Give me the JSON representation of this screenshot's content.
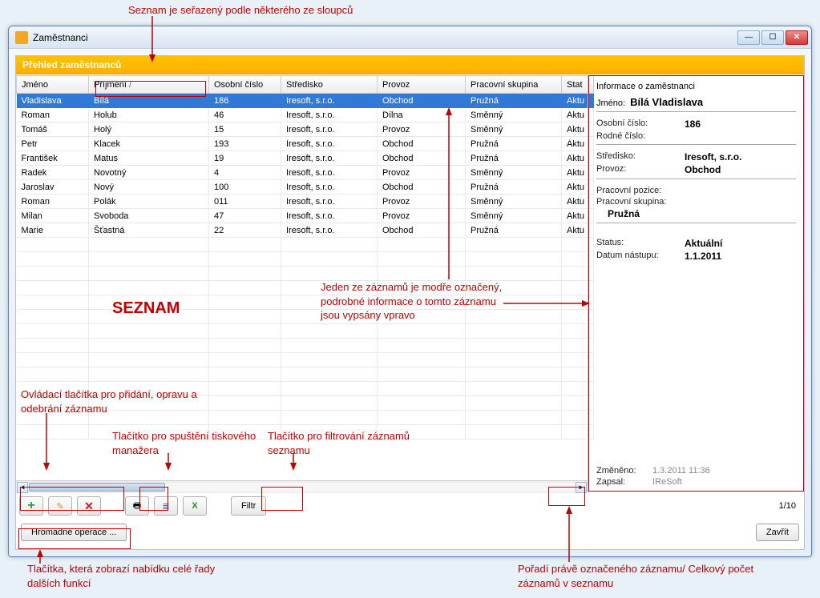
{
  "annotations": {
    "top": "Seznam je seřazený podle některého ze sloupců",
    "seznam": "SEZNAM",
    "right_note": "Jeden ze záznamů je modře označený, podrobné informace o tomto záznamu jsou vypsány vpravo",
    "controls_note": "Ovládací tlačítka pro přidání, opravu a odebrání záznamu",
    "print_note": "Tlačítko pro spuštění tiskového manažera",
    "filter_note": "Tlačítko pro filtrování záznamů seznamu",
    "bottom_left": "Tlačítka, která zobrazí nabídku celé řady dalších funkcí",
    "bottom_right": "Pořadí právě označeného záznamu/ Celkový počet záznamů v seznamu"
  },
  "window": {
    "title": "Zaměstnanci",
    "header": "Přehled zaměstnanců"
  },
  "columns": [
    "Jméno",
    "Příjmení",
    "Osobní číslo",
    "Středisko",
    "Provoz",
    "Pracovní skupina",
    "Stat"
  ],
  "sorted_col_index": 1,
  "rows": [
    {
      "sel": true,
      "c": [
        "Vladislava",
        "Bílá",
        "186",
        "Iresoft, s.r.o.",
        "Obchod",
        "Pružná",
        "Aktu"
      ]
    },
    {
      "sel": false,
      "c": [
        "Roman",
        "Holub",
        "46",
        "Iresoft, s.r.o.",
        "Dílna",
        "Směnný",
        "Aktu"
      ]
    },
    {
      "sel": false,
      "c": [
        "Tomáš",
        "Holý",
        "15",
        "Iresoft, s.r.o.",
        "Provoz",
        "Směnný",
        "Aktu"
      ]
    },
    {
      "sel": false,
      "c": [
        "Petr",
        "Klacek",
        "193",
        "Iresoft, s.r.o.",
        "Obchod",
        "Pružná",
        "Aktu"
      ]
    },
    {
      "sel": false,
      "c": [
        "František",
        "Matus",
        "19",
        "Iresoft, s.r.o.",
        "Obchod",
        "Pružná",
        "Aktu"
      ]
    },
    {
      "sel": false,
      "c": [
        "Radek",
        "Novotný",
        "4",
        "Iresoft, s.r.o.",
        "Provoz",
        "Směnný",
        "Aktu"
      ]
    },
    {
      "sel": false,
      "c": [
        "Jaroslav",
        "Nový",
        "100",
        "Iresoft, s.r.o.",
        "Obchod",
        "Pružná",
        "Aktu"
      ]
    },
    {
      "sel": false,
      "c": [
        "Roman",
        "Polák",
        "011",
        "Iresoft, s.r.o.",
        "Provoz",
        "Směnný",
        "Aktu"
      ]
    },
    {
      "sel": false,
      "c": [
        "Milan",
        "Svoboda",
        "47",
        "Iresoft, s.r.o.",
        "Provoz",
        "Směnný",
        "Aktu"
      ]
    },
    {
      "sel": false,
      "c": [
        "Marie",
        "Šťastná",
        "22",
        "Iresoft, s.r.o.",
        "Obchod",
        "Pružná",
        "Aktu"
      ]
    }
  ],
  "detail": {
    "title": "Informace o zaměstnanci",
    "name_label": "Jméno:",
    "name_value": "Bílá Vladislava",
    "osobni_cislo_label": "Osobní číslo:",
    "osobni_cislo_value": "186",
    "rodne_label": "Rodné číslo:",
    "rodne_value": "",
    "stredisko_label": "Středisko:",
    "stredisko_value": "Iresoft, s.r.o.",
    "provoz_label": "Provoz:",
    "provoz_value": "Obchod",
    "pozice_label": "Pracovní pozice:",
    "pozice_value": "",
    "skupina_label": "Pracovní skupina:",
    "skupina_value": "Pružná",
    "status_label": "Status:",
    "status_value": "Aktuální",
    "nastup_label": "Datum nástupu:",
    "nastup_value": "1.1.2011",
    "zmeneno_label": "Změněno:",
    "zmeneno_value": "1.3.2011 11:36",
    "zapsal_label": "Zapsal:",
    "zapsal_value": "IReSoft"
  },
  "toolbar": {
    "filter": "Filtr",
    "counter": "1/10",
    "batch": "Hromadné operace ...",
    "close": "Zavřít"
  },
  "icons": {
    "add": "+",
    "edit": "✎",
    "delete": "✕",
    "print": "🖶",
    "list": "≣",
    "excel": "X"
  }
}
